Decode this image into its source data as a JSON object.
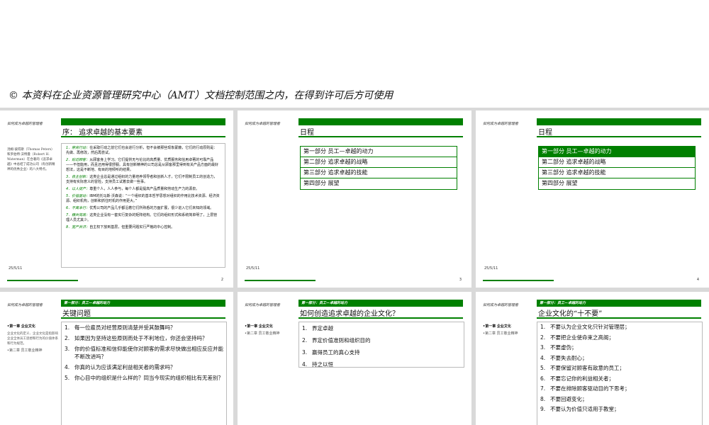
{
  "banner": "© 本资料在企业资源管理研究中心（AMT）文档控制范围之内，在得到许可后方可使用",
  "header_small": "如何成为卓越的管理者",
  "slide1": {
    "title": "序：  追求卓越的基本要素",
    "side_note": "汤姆·彼得斯（Thomas Peters）和罗伯特·沃特曼（Robert H. Waterman）在合著的《追求卓越》中总结了成功公司（有创新精神的优秀企业）的八大特点。",
    "items": [
      {
        "kw": "1．崇尚行动：",
        "text": "在采取行动之前它们也会进行分析，但不会被那些现象蒙蔽，它们的行动原则是：先做、再修改，然后再尝试。"
      },
      {
        "kw": "2．贴近顾客：",
        "text": "从顾客身上学习。它们提供无与伦比的高质量、优质服务和信用卓著的可靠产品——不但能用，而且还用得很舒服。具有创新精神的公司总是从顾客那里得到有关产品方面的最好想法，这是不断地、有目的地倾听的结果。"
      },
      {
        "kw": "3．自主创新：",
        "text": "这类企业总是通过组织的力量培养领导者和创新人才，它们不限制员工的创造力，支持有实际意义的冒险，支持员工试着去做一些事。"
      },
      {
        "kw": "4．以人促产：",
        "text": "尊重个人，人人参与，每个人都是提高产品质量和劳动生产力的源泉。"
      },
      {
        "kw": "5．价值驱动：",
        "text": "IBM的托马斯·沃森说：“一个组织的基本哲学思想对组织的作用比技术资源、经济资源、组织机构，创新和抓住时机的作用更大。”"
      },
      {
        "kw": "6．不离本行：",
        "text": "优秀公司的产品几乎都沿着它们所熟悉的方面扩展，很少进入它们未知的领域。"
      },
      {
        "kw": "7．精兵简政：",
        "text": "这类企业没有一套实行复杂的矩阵结构。它们的组织形式和系统简单明了，上层管理人员尤其少。"
      },
      {
        "kw": "8．宽严并济：",
        "text": "自主权下放到基层，但重要问题实行严格的中心控制。"
      }
    ],
    "date": "25/5/11",
    "page": "2"
  },
  "slide2": {
    "title": "日程",
    "agenda": [
      "第一部分 员工—卓越的动力",
      "第二部分 追求卓越的战略",
      "第三部分 追求卓越的技能",
      "第四部分 展望"
    ],
    "date": "25/5/11",
    "page": "3"
  },
  "slide3": {
    "title": "日程",
    "agenda": [
      "第一部分 员工—卓越的动力",
      "第二部分 追求卓越的战略",
      "第三部分 追求卓越的技能",
      "第四部分 展望"
    ],
    "active_index": 0,
    "date": "25/5/11",
    "page": "4"
  },
  "slide4": {
    "bar_label": "第一部分：员工—卓越的动力",
    "title": "关键问题",
    "nav_active": "•第一章 企业文化",
    "nav_desc": "企业文化的定义、企业文化是指影响企业全体员工思想和行为的价值体系和行为规范。",
    "nav_item": "•第二章 员工敬业精神",
    "questions": [
      "每一位雇员对经营原则清楚并受其鼓舞吗？",
      "如果因为坚持这些原则而处于不利地位，你还会坚持吗？",
      "你的价值标准和信仰能使你对顾客的需求尽快做出相应反应并能不断改进吗？",
      "你真的认为应该满足利益相关者的需求吗？",
      "你心目中的组织是什么样的？同当今现实的组织相比有无差别？"
    ]
  },
  "slide5": {
    "bar_label": "第一部分：员工—卓越的动力",
    "title": "如何创造追求卓越的企业文化？",
    "nav_active": "•第一章 企业文化",
    "nav_item": "•第二章 员工敬业精神",
    "steps": [
      "界定卓越",
      "界定价值准则和组织目的",
      "赢得员工的真心支持",
      "持之以恒"
    ]
  },
  "slide6": {
    "bar_label": "第一部分：员工—卓越的动力",
    "title": "企业文化的“十不要”",
    "nav_active": "•第一章 企业文化",
    "nav_item": "•第二章 员工敬业精神",
    "donts": [
      "不要认为企业文化只针对管理层；",
      "不要把企业使命束之高阁；",
      "不要虚伪；",
      "不要失去耐心；",
      "不要保留对顾客有敌意的员工；",
      "不要忘记你的利益相关者；",
      "不要在排除顾客驱动目的下思考；",
      "不要回避变化；",
      "不要认为价值只适用于教堂；"
    ]
  }
}
